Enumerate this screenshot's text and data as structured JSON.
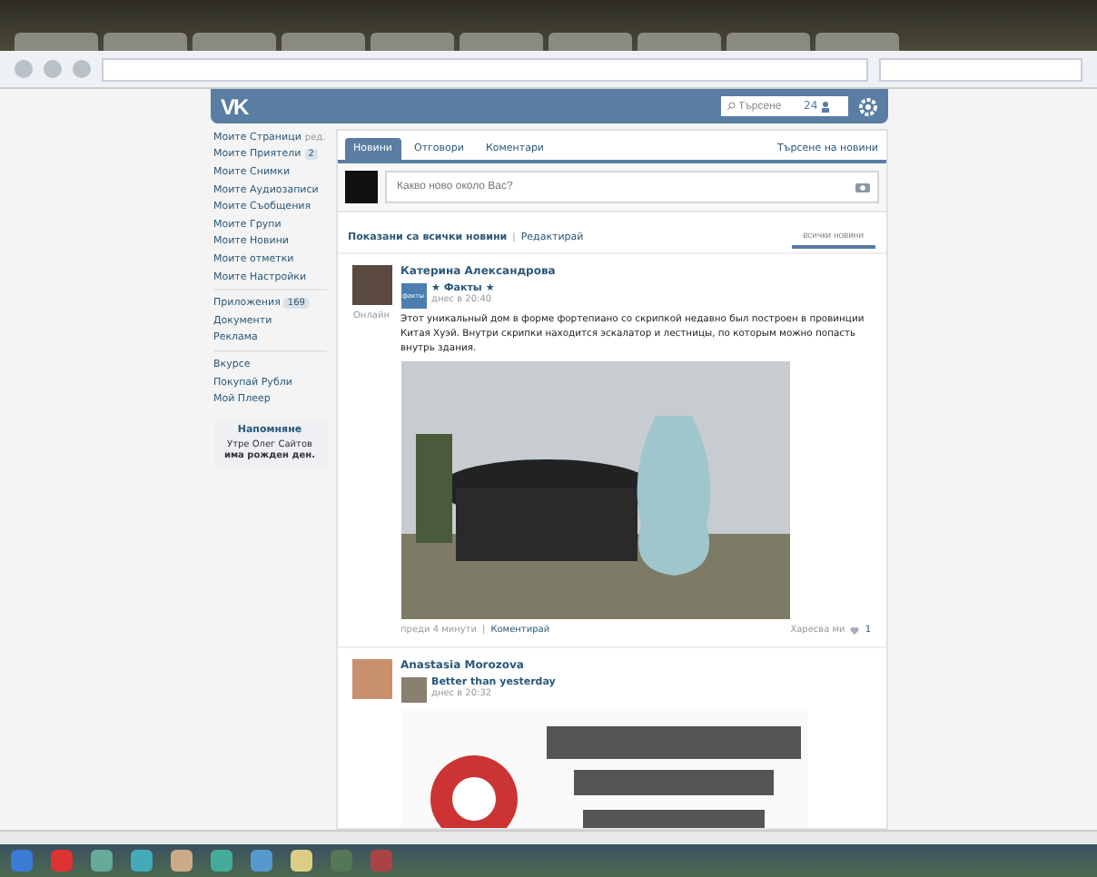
{
  "header": {
    "logo": "VK",
    "search": {
      "placeholder": "Търсене"
    },
    "online_count": "24"
  },
  "menu": [
    {
      "label": "Моите Страници",
      "extra": "ред."
    },
    {
      "label": "Моите Приятели",
      "badge": "2"
    },
    {
      "label": "Моите Снимки"
    },
    {
      "label": "Моите Аудиозаписи"
    },
    {
      "label": "Моите Съобщения"
    },
    {
      "label": "Моите Групи"
    },
    {
      "label": "Моите Новини"
    },
    {
      "label": "Моите отметки"
    },
    {
      "label": "Моите Настройки",
      "divider_after": true
    },
    {
      "label": "Приложения",
      "badge": "169"
    },
    {
      "label": "Документи"
    },
    {
      "label": "Реклама",
      "divider_after": true
    },
    {
      "label": "Вкурсе"
    },
    {
      "label": "Покупай Рубли"
    },
    {
      "label": "Мой Плеер"
    }
  ],
  "reminder": {
    "title": "Напомняне",
    "text": "Утре Олег Сайтов **има рожден ден.**"
  },
  "tabs": [
    {
      "label": "Новини",
      "selected": true
    },
    {
      "label": "Отговори",
      "selected": false
    },
    {
      "label": "Коментари",
      "selected": false
    }
  ],
  "news_search_link": "Търсене на новини",
  "composer": {
    "placeholder": "Какво ново около Вас?"
  },
  "filter": {
    "summary": "Показани са всички новини",
    "separator": "|",
    "edit": "Редактирай",
    "tabs": [
      {
        "label": "всички новини",
        "selected": true
      }
    ]
  },
  "posts": [
    {
      "author": "Катерина Александрова",
      "online": "Онлайн",
      "source": "★ Факты ★",
      "source_thumb": "факты",
      "time": "днес в 20:40",
      "text": "Этот уникальный дом в форме фортепиано со скрипкой недавно был построен в провинции Китая Хуэй. Внутри скрипки находится эскалатор и лестницы, по которым можно попасть внутрь здания.",
      "footer": {
        "ago": "преди 4 минути",
        "separator": "|",
        "comment": "Коментирай",
        "like": "Харесва ми",
        "likes": "1"
      }
    },
    {
      "author": "Anastasia Morozova",
      "source": "Better than yesterday",
      "time": "днес в 20:32"
    }
  ]
}
